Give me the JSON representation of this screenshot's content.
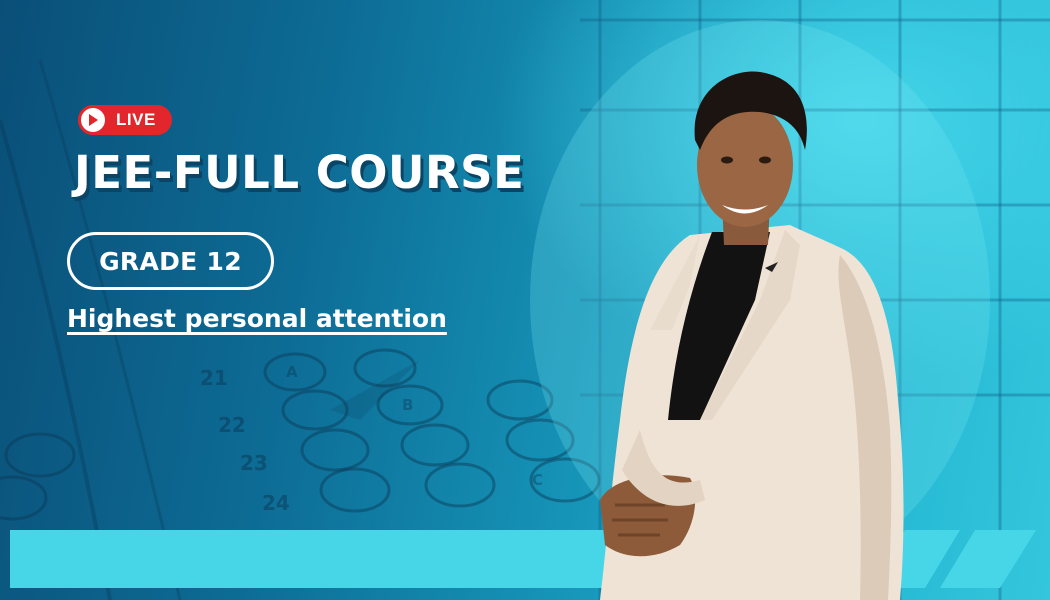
{
  "banner": {
    "live_label": "LIVE",
    "title": "JEE-FULL COURSE",
    "grade_label": "GRADE 12",
    "tagline": "Highest personal attention"
  },
  "background": {
    "answer_sheet_numbers": [
      "21",
      "22",
      "23",
      "24"
    ],
    "bubble_letters": [
      "A",
      "B",
      "C"
    ]
  },
  "colors": {
    "live_badge": "#e3262c",
    "accent_bar": "#46d6e8",
    "text": "#ffffff",
    "title_shadow": "#0a4566"
  },
  "icons": {
    "live_play": "play-icon"
  }
}
